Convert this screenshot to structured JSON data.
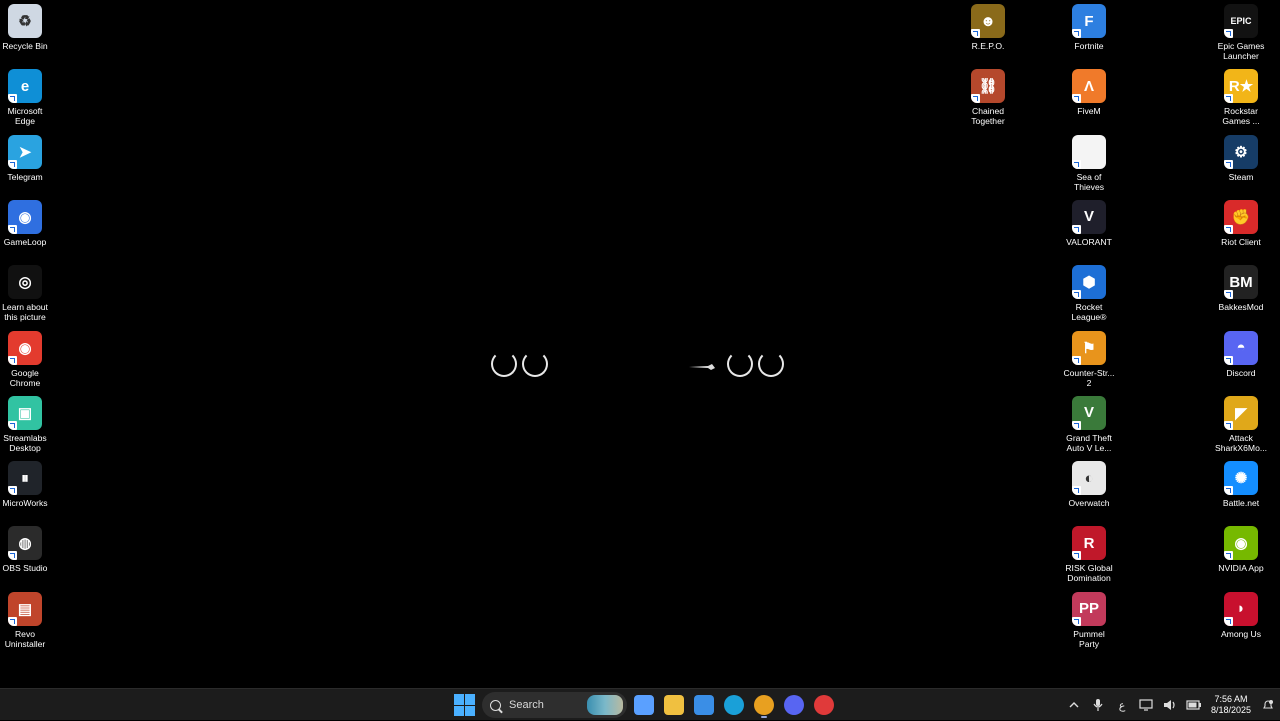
{
  "desktop": {
    "icons": [
      {
        "label": "Recycle Bin",
        "icon": "recycle-bin-icon",
        "bg": "#cfd8e3",
        "glyph": "♻",
        "shortcut": false
      },
      {
        "label": "Microsoft\nEdge",
        "icon": "edge-icon",
        "bg": "#0f8fd6",
        "glyph": "e",
        "shortcut": true
      },
      {
        "label": "Telegram",
        "icon": "telegram-icon",
        "bg": "#2aa3e0",
        "glyph": "➤",
        "shortcut": true
      },
      {
        "label": "GameLoop",
        "icon": "gameloop-icon",
        "bg": "#2f6fe0",
        "glyph": "◉",
        "shortcut": true
      },
      {
        "label": "Learn about\nthis picture",
        "icon": "learn-picture-icon",
        "bg": "#111111",
        "glyph": "◎",
        "shortcut": false
      },
      {
        "label": "Google\nChrome",
        "icon": "chrome-icon",
        "bg": "#e33b2e",
        "glyph": "◉",
        "shortcut": true
      },
      {
        "label": "Streamlabs\nDesktop",
        "icon": "streamlabs-icon",
        "bg": "#31c3a2",
        "glyph": "▣",
        "shortcut": true
      },
      {
        "label": "MicroWorks",
        "icon": "microworks-icon",
        "bg": "#20242a",
        "glyph": "⏸",
        "shortcut": true
      },
      {
        "label": "OBS Studio",
        "icon": "obs-icon",
        "bg": "#2b2b2b",
        "glyph": "◍",
        "shortcut": true
      },
      {
        "label": "Revo\nUninstaller",
        "icon": "revo-uninstaller-icon",
        "bg": "#c0452b",
        "glyph": "▤",
        "shortcut": true
      },
      {
        "label": "R.E.P.O.",
        "icon": "repo-icon",
        "bg": "#8a6a1a",
        "glyph": "☻",
        "shortcut": true
      },
      {
        "label": "Chained\nTogether",
        "icon": "chained-together-icon",
        "bg": "#b5482c",
        "glyph": "⛓",
        "shortcut": true
      },
      {
        "label": "Fortnite",
        "icon": "fortnite-icon",
        "bg": "#2d7fe0",
        "glyph": "F",
        "shortcut": true
      },
      {
        "label": "FiveM",
        "icon": "fivem-icon",
        "bg": "#f07a2a",
        "glyph": "Λ",
        "shortcut": true
      },
      {
        "label": "Sea of\nThieves",
        "icon": "file-icon",
        "bg": "#f4f4f4",
        "glyph": "",
        "shortcut": true
      },
      {
        "label": "VALORANT",
        "icon": "valorant-icon",
        "bg": "#1f1f2b",
        "glyph": "V",
        "shortcut": true
      },
      {
        "label": "Rocket\nLeague®",
        "icon": "rocket-league-icon",
        "bg": "#1d6fd6",
        "glyph": "⬢",
        "shortcut": true
      },
      {
        "label": "Counter-Str...\n2",
        "icon": "counter-strike-icon",
        "bg": "#e8941c",
        "glyph": "⚑",
        "shortcut": true
      },
      {
        "label": "Grand Theft\nAuto V Le...",
        "icon": "gta-v-icon",
        "bg": "#3a7a3a",
        "glyph": "V",
        "shortcut": true
      },
      {
        "label": "Overwatch",
        "icon": "overwatch-icon",
        "bg": "#e8e8e8",
        "glyph": "◐",
        "shortcut": true
      },
      {
        "label": "RISK Global\nDomination",
        "icon": "risk-icon",
        "bg": "#c0182a",
        "glyph": "R",
        "shortcut": true
      },
      {
        "label": "Pummel\nParty",
        "icon": "pummel-party-icon",
        "bg": "#c23a5b",
        "glyph": "PP",
        "shortcut": true
      },
      {
        "label": "Epic Games\nLauncher",
        "icon": "epic-games-icon",
        "bg": "#121212",
        "glyph": "EPIC",
        "shortcut": true
      },
      {
        "label": "Rockstar\nGames ...",
        "icon": "rockstar-icon",
        "bg": "#f2b518",
        "glyph": "R★",
        "shortcut": true
      },
      {
        "label": "Steam",
        "icon": "steam-icon",
        "bg": "#163c66",
        "glyph": "⚙",
        "shortcut": true
      },
      {
        "label": "Riot Client",
        "icon": "riot-client-icon",
        "bg": "#d92a2a",
        "glyph": "✊",
        "shortcut": true
      },
      {
        "label": "BakkesMod",
        "icon": "bakkesmod-icon",
        "bg": "#222222",
        "glyph": "BM",
        "shortcut": true
      },
      {
        "label": "Discord",
        "icon": "discord-icon",
        "bg": "#5865f2",
        "glyph": "◓",
        "shortcut": true
      },
      {
        "label": "Attack\nSharkX6Mo...",
        "icon": "attack-shark-icon",
        "bg": "#e0a81a",
        "glyph": "◤",
        "shortcut": true
      },
      {
        "label": "Battle.net",
        "icon": "battlenet-icon",
        "bg": "#148eff",
        "glyph": "✺",
        "shortcut": true
      },
      {
        "label": "NVIDIA App",
        "icon": "nvidia-icon",
        "bg": "#76b900",
        "glyph": "◉",
        "shortcut": true
      },
      {
        "label": "Among Us",
        "icon": "among-us-icon",
        "bg": "#c8102e",
        "glyph": "◗",
        "shortcut": true
      }
    ]
  },
  "taskbar": {
    "search_label": "Search",
    "apps": [
      {
        "icon": "copilot-icon",
        "color": "#5aa0ff"
      },
      {
        "icon": "file-explorer-icon",
        "color": "#f0c040"
      },
      {
        "icon": "microsoft-store-icon",
        "color": "#3a8ee6"
      },
      {
        "icon": "edge-icon",
        "color": "#1aa0d8"
      },
      {
        "icon": "chrome-icon",
        "color": "#e8a020"
      },
      {
        "icon": "discord-icon",
        "color": "#5865f2"
      },
      {
        "icon": "riot-client-icon",
        "color": "#e03a3a"
      }
    ],
    "tray": {
      "language": "ع",
      "time": "7:56 AM",
      "date": "8/18/2025"
    }
  }
}
